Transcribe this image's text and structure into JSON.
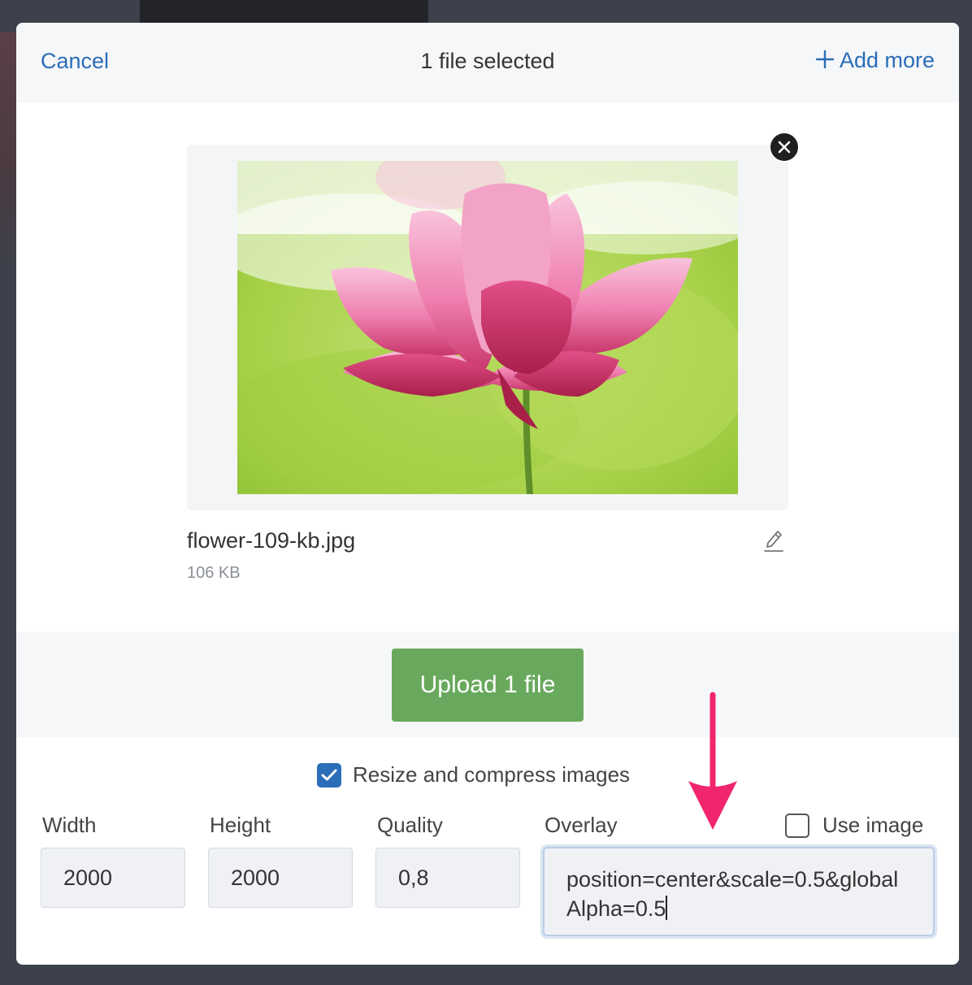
{
  "header": {
    "cancel_label": "Cancel",
    "title": "1 file selected",
    "add_more_label": "Add more"
  },
  "file": {
    "name": "flower-109-kb.jpg",
    "size": "106 KB"
  },
  "upload": {
    "button_label": "Upload 1 file"
  },
  "options": {
    "resize_label": "Resize and compress images",
    "resize_checked": true,
    "width_label": "Width",
    "width_value": "2000",
    "height_label": "Height",
    "height_value": "2000",
    "quality_label": "Quality",
    "quality_value": "0,8",
    "overlay_label": "Overlay",
    "overlay_value": "position=center&scale=0.5&globalAlpha=0.5",
    "use_image_label": "Use image",
    "use_image_checked": false
  },
  "colors": {
    "accent": "#2a6db8",
    "upload_button": "#69a95d",
    "annotation_arrow": "#f0256e"
  }
}
